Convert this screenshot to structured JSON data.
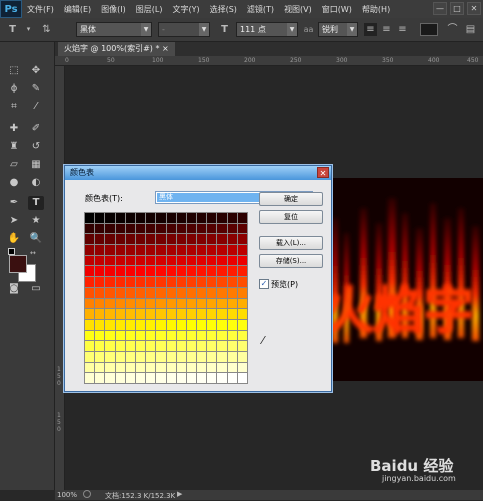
{
  "app": {
    "logo": "Ps"
  },
  "menu": [
    "文件(F)",
    "编辑(E)",
    "图像(I)",
    "图层(L)",
    "文字(Y)",
    "选择(S)",
    "滤镜(T)",
    "视图(V)",
    "窗口(W)",
    "帮助(H)"
  ],
  "window_controls": [
    "—",
    "□",
    "✕"
  ],
  "options": {
    "font_family": "黑体",
    "font_style": "-",
    "font_size": "111 点",
    "antialias": "锐利"
  },
  "document_tab": "火焰字 @ 100%(索引#) * ×",
  "rulers": {
    "top": [
      "0",
      "50",
      "100",
      "150",
      "200",
      "250",
      "300",
      "350",
      "400",
      "450"
    ],
    "left": [
      "1",
      "5",
      "0",
      "1",
      "5",
      "0"
    ]
  },
  "dialog": {
    "title": "颜色表",
    "close": "✕",
    "table_label": "颜色表(T):",
    "table_value": "黑体",
    "buttons": {
      "ok": "确定",
      "reset": "复位",
      "load": "载入(L)...",
      "save": "存储(S)..."
    },
    "preview_check": "✓",
    "preview_label": "预览(P)"
  },
  "status": {
    "zoom": "100%",
    "doc": "文档:152.3 K/152.3K"
  },
  "artwork": {
    "text": "火焰字"
  },
  "watermark": {
    "brand": "Baidu 经验",
    "url": "jingyan.baidu.com"
  }
}
